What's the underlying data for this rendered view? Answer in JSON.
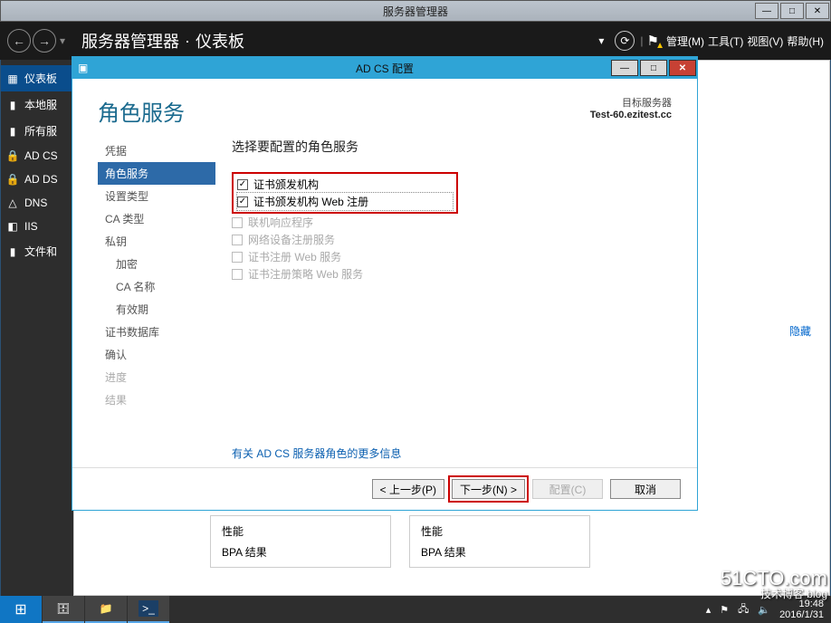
{
  "outerWindow": {
    "title": "服务器管理器"
  },
  "smHeader": {
    "breadcrumb_app": "服务器管理器",
    "breadcrumb_sep": "·",
    "breadcrumb_page": "仪表板",
    "menu_manage": "管理(M)",
    "menu_tools": "工具(T)",
    "menu_view": "视图(V)",
    "menu_help": "帮助(H)"
  },
  "smLeft": {
    "items": [
      {
        "icon": "▦",
        "label": "仪表板",
        "selected": true
      },
      {
        "icon": "▮",
        "label": "本地服"
      },
      {
        "icon": "▮",
        "label": "所有服"
      },
      {
        "icon": "🔒",
        "label": "AD CS"
      },
      {
        "icon": "🔒",
        "label": "AD DS"
      },
      {
        "icon": "△",
        "label": "DNS"
      },
      {
        "icon": "◧",
        "label": "IIS"
      },
      {
        "icon": "▮",
        "label": "文件和"
      }
    ]
  },
  "smMain": {
    "hide": "隐藏",
    "bpa_header": "性能",
    "bpa_result": "BPA 结果"
  },
  "dialog": {
    "title": "AD CS 配置",
    "heading": "角色服务",
    "target_label": "目标服务器",
    "target_value": "Test-60.ezitest.cc",
    "nav": {
      "cred": "凭据",
      "role": "角色服务",
      "setuptype": "设置类型",
      "catype": "CA 类型",
      "privkey": "私钥",
      "crypto": "加密",
      "caname": "CA 名称",
      "validity": "有效期",
      "certdb": "证书数据库",
      "confirm": "确认",
      "progress": "进度",
      "result": "结果"
    },
    "content_title": "选择要配置的角色服务",
    "roles": [
      {
        "label": "证书颁发机构",
        "checked": true,
        "enabled": true
      },
      {
        "label": "证书颁发机构 Web 注册",
        "checked": true,
        "enabled": true
      },
      {
        "label": "联机响应程序",
        "checked": false,
        "enabled": false
      },
      {
        "label": "网络设备注册服务",
        "checked": false,
        "enabled": false
      },
      {
        "label": "证书注册 Web 服务",
        "checked": false,
        "enabled": false
      },
      {
        "label": "证书注册策略 Web 服务",
        "checked": false,
        "enabled": false
      }
    ],
    "learn_more": "有关 AD CS 服务器角色的更多信息",
    "buttons": {
      "prev": "< 上一步(P)",
      "next": "下一步(N) >",
      "configure": "配置(C)",
      "cancel": "取消"
    }
  },
  "taskbar": {
    "time": "19:48",
    "date": "2016/1/31"
  },
  "watermark": {
    "main": "51CTO.com",
    "sub": "技术博客  blog"
  }
}
